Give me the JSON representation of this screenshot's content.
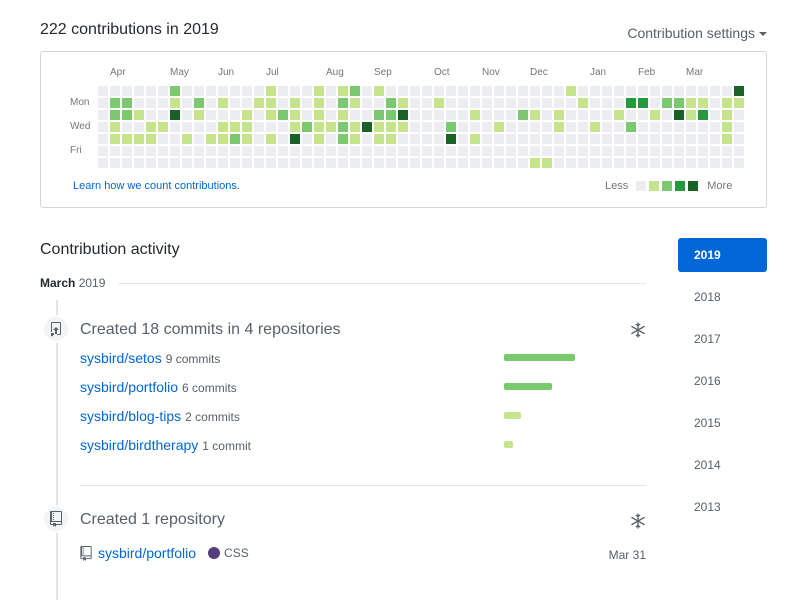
{
  "header": {
    "title": "222 contributions in 2019",
    "settings_label": "Contribution settings"
  },
  "graph": {
    "months": [
      {
        "label": "Apr",
        "col": 1
      },
      {
        "label": "May",
        "col": 6
      },
      {
        "label": "Jun",
        "col": 10
      },
      {
        "label": "Jul",
        "col": 14
      },
      {
        "label": "Aug",
        "col": 19
      },
      {
        "label": "Sep",
        "col": 23
      },
      {
        "label": "Oct",
        "col": 28
      },
      {
        "label": "Nov",
        "col": 32
      },
      {
        "label": "Dec",
        "col": 36
      },
      {
        "label": "Jan",
        "col": 41
      },
      {
        "label": "Feb",
        "col": 45
      },
      {
        "label": "Mar",
        "col": 49
      }
    ],
    "weekdays": {
      "mon": "Mon",
      "wed": "Wed",
      "fri": "Fri"
    },
    "colors": [
      "#ebedf0",
      "#c6e48b",
      "#7bc96f",
      "#239a3b",
      "#196127"
    ],
    "learn_link": "Learn how we count contributions.",
    "legend_less": "Less",
    "legend_more": "More",
    "weeks": [
      [
        0,
        0,
        0,
        0,
        0,
        0,
        0
      ],
      [
        0,
        2,
        2,
        1,
        1,
        0,
        0
      ],
      [
        0,
        2,
        2,
        0,
        1,
        0,
        0
      ],
      [
        0,
        0,
        1,
        0,
        1,
        0,
        0
      ],
      [
        0,
        0,
        0,
        1,
        1,
        0,
        0
      ],
      [
        0,
        0,
        0,
        1,
        0,
        0,
        0
      ],
      [
        2,
        1,
        4,
        0,
        0,
        0,
        0
      ],
      [
        0,
        0,
        0,
        0,
        1,
        0,
        0
      ],
      [
        0,
        2,
        1,
        0,
        0,
        0,
        0
      ],
      [
        0,
        0,
        0,
        0,
        1,
        0,
        0
      ],
      [
        0,
        1,
        0,
        1,
        1,
        0,
        0
      ],
      [
        0,
        0,
        0,
        1,
        2,
        0,
        0
      ],
      [
        0,
        0,
        1,
        1,
        1,
        0,
        0
      ],
      [
        0,
        1,
        0,
        0,
        0,
        0,
        0
      ],
      [
        1,
        1,
        1,
        0,
        1,
        0,
        0
      ],
      [
        0,
        0,
        2,
        0,
        0,
        0,
        0
      ],
      [
        0,
        1,
        1,
        1,
        4,
        0,
        0
      ],
      [
        0,
        0,
        0,
        2,
        0,
        0,
        0
      ],
      [
        1,
        1,
        1,
        1,
        1,
        0,
        0
      ],
      [
        0,
        0,
        0,
        1,
        0,
        0,
        0
      ],
      [
        1,
        2,
        1,
        2,
        2,
        0,
        0
      ],
      [
        2,
        1,
        0,
        1,
        1,
        0,
        0
      ],
      [
        0,
        0,
        0,
        4,
        0,
        0,
        0
      ],
      [
        1,
        0,
        2,
        1,
        1,
        0,
        0
      ],
      [
        0,
        2,
        2,
        1,
        1,
        0,
        0
      ],
      [
        0,
        1,
        4,
        1,
        0,
        0,
        0
      ],
      [
        0,
        0,
        0,
        0,
        0,
        0,
        0
      ],
      [
        0,
        0,
        0,
        0,
        0,
        0,
        0
      ],
      [
        0,
        1,
        0,
        0,
        0,
        0,
        0
      ],
      [
        0,
        0,
        0,
        2,
        4,
        0,
        0
      ],
      [
        0,
        0,
        0,
        0,
        0,
        0,
        0
      ],
      [
        0,
        0,
        1,
        0,
        1,
        0,
        0
      ],
      [
        0,
        0,
        0,
        0,
        0,
        0,
        0
      ],
      [
        0,
        0,
        0,
        1,
        0,
        0,
        0
      ],
      [
        0,
        0,
        0,
        0,
        0,
        0,
        0
      ],
      [
        0,
        0,
        2,
        0,
        0,
        0,
        0
      ],
      [
        0,
        0,
        1,
        0,
        0,
        0,
        1
      ],
      [
        0,
        0,
        0,
        0,
        0,
        0,
        1
      ],
      [
        0,
        0,
        1,
        1,
        0,
        0,
        0
      ],
      [
        1,
        0,
        0,
        0,
        0,
        0,
        0
      ],
      [
        0,
        1,
        0,
        0,
        0,
        0,
        0
      ],
      [
        0,
        0,
        0,
        1,
        0,
        0,
        0
      ],
      [
        0,
        0,
        0,
        0,
        0,
        0,
        0
      ],
      [
        0,
        0,
        1,
        0,
        0,
        0,
        0
      ],
      [
        0,
        3,
        0,
        2,
        0,
        0,
        0
      ],
      [
        0,
        3,
        0,
        0,
        0,
        0,
        0
      ],
      [
        0,
        0,
        1,
        0,
        0,
        0,
        0
      ],
      [
        0,
        2,
        0,
        0,
        0,
        0,
        0
      ],
      [
        0,
        2,
        4,
        0,
        0,
        0,
        0
      ],
      [
        0,
        1,
        1,
        0,
        0,
        0,
        0
      ],
      [
        0,
        1,
        3,
        0,
        0,
        0,
        0
      ],
      [
        0,
        0,
        0,
        0,
        0,
        0,
        0
      ],
      [
        0,
        1,
        1,
        1,
        1,
        0,
        0
      ],
      [
        4,
        1,
        0,
        0,
        0,
        0,
        0
      ]
    ]
  },
  "activity": {
    "title": "Contribution activity",
    "month": "March",
    "year": "2019",
    "commits_section": {
      "title": "Created 18 commits in 4 repositories",
      "repos": [
        {
          "name": "sysbird/setos",
          "count": "9 commits",
          "bar_fraction": 1.0,
          "color": "#7bc96f"
        },
        {
          "name": "sysbird/portfolio",
          "count": "6 commits",
          "bar_fraction": 0.67,
          "color": "#7bc96f"
        },
        {
          "name": "sysbird/blog-tips",
          "count": "2 commits",
          "bar_fraction": 0.24,
          "color": "#c6e48b"
        },
        {
          "name": "sysbird/birdtherapy",
          "count": "1 commit",
          "bar_fraction": 0.12,
          "color": "#c6e48b"
        }
      ]
    },
    "repo_section": {
      "title": "Created 1 repository",
      "repo_name": "sysbird/portfolio",
      "language": "CSS",
      "language_color": "#563d7c",
      "date": "Mar 31"
    }
  },
  "years": [
    "2019",
    "2018",
    "2017",
    "2016",
    "2015",
    "2014",
    "2013"
  ],
  "icons": {
    "commit_badge": "repo-push-icon",
    "repo_badge": "repo-icon",
    "collapse": "unfold-icon"
  }
}
